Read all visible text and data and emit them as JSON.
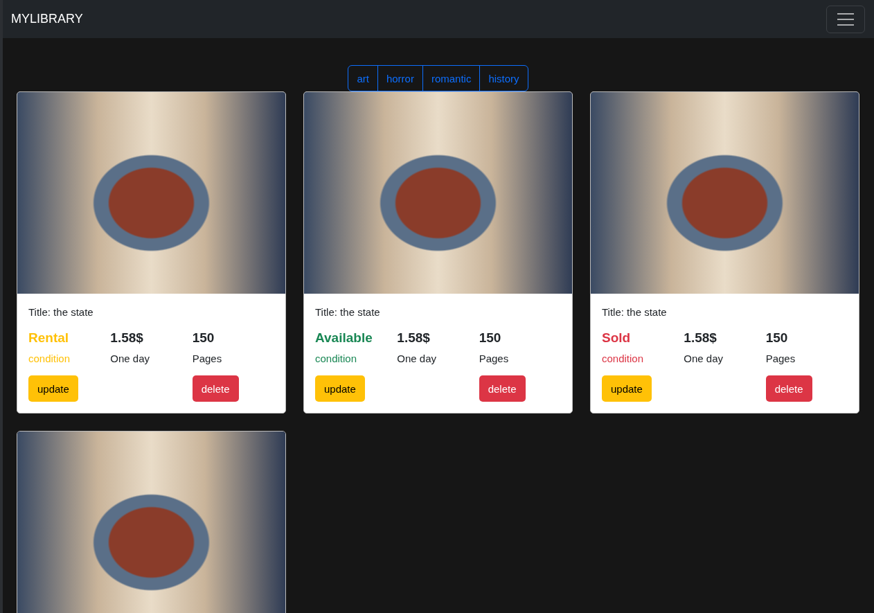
{
  "navbar": {
    "brand": "MYLIBRARY"
  },
  "filters": [
    "art",
    "horror",
    "romantic",
    "history"
  ],
  "cards": [
    {
      "kind": "full",
      "title": "Title: the state",
      "status": "Rental",
      "color": "#ffc107",
      "status_caption": "condition",
      "price": "1.58$",
      "price_caption": "One day",
      "pages": "150",
      "pages_caption": "Pages",
      "buttons": [
        "update",
        "delete"
      ]
    },
    {
      "kind": "full",
      "title": "Title: the state",
      "status": "Available",
      "color": "#198754",
      "status_caption": "condition",
      "price": "1.58$",
      "price_caption": "One day",
      "pages": "150",
      "pages_caption": "Pages",
      "buttons": [
        "update",
        "delete"
      ]
    },
    {
      "kind": "full",
      "title": "Title: the state",
      "status": "Sold",
      "color": "#dc3545",
      "status_caption": "condition",
      "price": "1.58$",
      "price_caption": "One day",
      "pages": "150",
      "pages_caption": "Pages",
      "buttons": [
        "update",
        "delete"
      ]
    },
    {
      "kind": "photo-only"
    }
  ]
}
